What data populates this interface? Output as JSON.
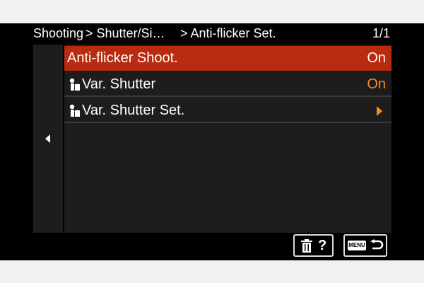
{
  "header": {
    "crumbs": [
      "Shooting",
      "> Shutter/Si…",
      "> Anti-flicker Set."
    ],
    "page_indicator": "1/1"
  },
  "menu": {
    "items": [
      {
        "label": "Anti-flicker Shoot.",
        "value": "On",
        "selected": true,
        "icon": ""
      },
      {
        "label": "Var. Shutter",
        "value": "On",
        "selected": false,
        "icon": "movie-camera-icon"
      },
      {
        "label": "Var. Shutter Set.",
        "value": "",
        "selected": false,
        "icon": "movie-camera-icon",
        "has_submenu": true
      }
    ]
  },
  "footer": {
    "delete_help_button": {
      "icons": [
        "trash-icon",
        "help-icon"
      ],
      "help_text": "?"
    },
    "menu_back_button": {
      "menu_label": "MENU",
      "icons": [
        "return-arrow-icon"
      ]
    }
  },
  "colors": {
    "accent_selected": "#b82b0e",
    "value_orange": "#ff8a1c",
    "panel": "#1d1d1d",
    "background": "#000000"
  }
}
